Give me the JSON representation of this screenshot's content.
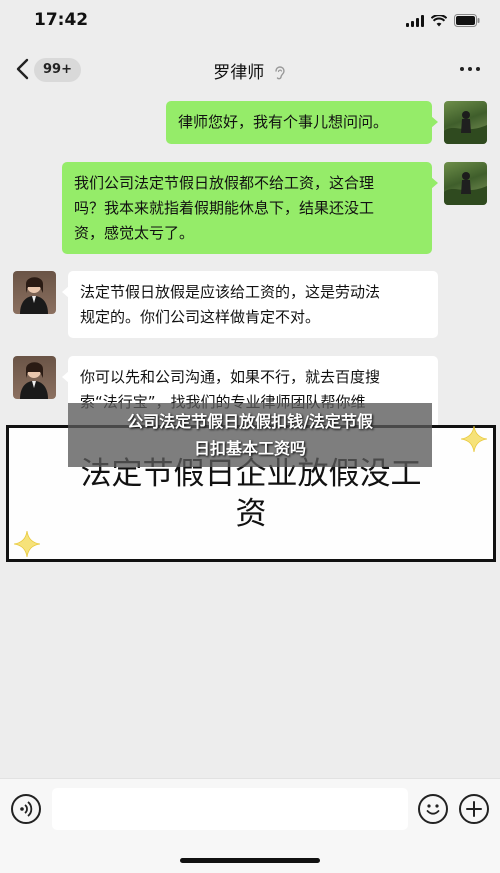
{
  "status_bar": {
    "time": "17:42"
  },
  "header": {
    "badge": "99+",
    "title": "罗律师",
    "icons": [
      "back-icon",
      "ear-icon",
      "more-icon"
    ]
  },
  "messages": [
    {
      "sender": "user",
      "lines": [
        "律师您好，我有个事儿想问问。"
      ]
    },
    {
      "sender": "user",
      "lines": [
        "我们公司法定节假日放假都不给工资，这合理",
        "吗？我本来就指着假期能休息下，结果还没工",
        "资，感觉太亏了。"
      ]
    },
    {
      "sender": "lawyer",
      "lines": [
        "法定节假日放假是应该给工资的，这是劳动法",
        "规定的。你们公司这样做肯定不对。"
      ]
    },
    {
      "sender": "lawyer",
      "lines": [
        "你可以先和公司沟通，如果不行，就去百度搜",
        "索“法行宝”，找我们的专业律师团队帮你维"
      ]
    }
  ],
  "overlay": {
    "caption_lines": [
      "公司法定节假日放假扣钱/法定节假",
      "日扣基本工资吗"
    ],
    "banner_lines": [
      "法定节假日企业放假没工",
      "资"
    ]
  },
  "input_bar": {
    "placeholder": "",
    "icons": [
      "voice-icon",
      "emoji-icon",
      "plus-icon"
    ]
  },
  "colors": {
    "background": "#ededed",
    "bubble_out": "#95ec69",
    "bubble_in": "#ffffff"
  }
}
